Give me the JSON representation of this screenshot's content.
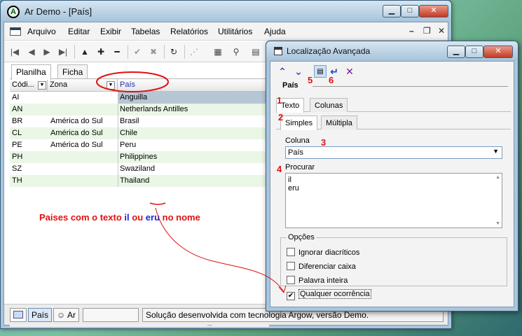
{
  "main": {
    "title": "Ar Demo - [País]",
    "menu": [
      "Arquivo",
      "Editar",
      "Exibir",
      "Tabelas",
      "Relatórios",
      "Utilitários",
      "Ajuda"
    ],
    "tabs": [
      "Planilha",
      "Ficha"
    ],
    "columns": [
      "Códi...",
      "Zona",
      "País"
    ],
    "rows": [
      {
        "code": "AI",
        "zona": "",
        "pais": "Anguilla"
      },
      {
        "code": "AN",
        "zona": "",
        "pais": "Netherlands Antilles"
      },
      {
        "code": "BR",
        "zona": "América do Sul",
        "pais": "Brasil"
      },
      {
        "code": "CL",
        "zona": "América do Sul",
        "pais": "Chile"
      },
      {
        "code": "PE",
        "zona": "América do Sul",
        "pais": "Peru"
      },
      {
        "code": "PH",
        "zona": "",
        "pais": "Philippines"
      },
      {
        "code": "SZ",
        "zona": "",
        "pais": "Swaziland"
      },
      {
        "code": "TH",
        "zona": "",
        "pais": "Thailand"
      }
    ],
    "selected_row": "AI",
    "annotation": {
      "part1": "Paises com o texto",
      "word1": "il",
      "word2": "ou",
      "word3": "eru",
      "part2": "no nome"
    },
    "status": {
      "tab1": "País",
      "tab2": "Ar",
      "message": "Solução desenvolvida com tecnologia Argow, versão Demo."
    }
  },
  "dialog": {
    "title": "Localização Avançada",
    "section": "País",
    "tabs_outer": [
      "Texto",
      "Colunas"
    ],
    "tabs_inner": [
      "Simples",
      "Múltipla"
    ],
    "coluna_label": "Coluna",
    "coluna_value": "País",
    "procurar_label": "Procurar",
    "procurar_lines": [
      "il",
      "eru"
    ],
    "opcoes_label": "Opções",
    "options": [
      {
        "label": "Ignorar diacríticos",
        "checked": false
      },
      {
        "label": "Diferenciar caixa",
        "checked": false
      },
      {
        "label": "Palavra inteira",
        "checked": false
      },
      {
        "label": "Qualquer ocorrência",
        "checked": true
      }
    ],
    "markers": [
      "1",
      "2",
      "3",
      "4",
      "5",
      "6"
    ]
  },
  "colors": {
    "annotation_red": "#e01010",
    "annotation_blue": "#1a2ad0",
    "row_alt": "#eaf6e6",
    "selection": "#b7c6d4"
  }
}
